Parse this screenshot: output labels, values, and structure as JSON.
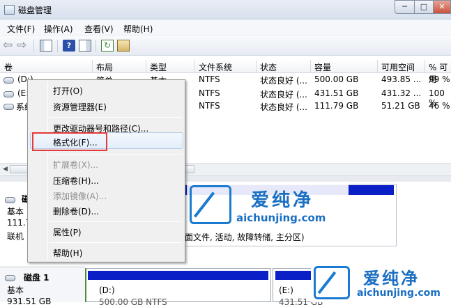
{
  "window": {
    "title": "磁盘管理",
    "buttons": {
      "min": "─",
      "max": "□",
      "close": "✕"
    }
  },
  "menubar": [
    "文件(F)",
    "操作(A)",
    "查看(V)",
    "帮助(H)"
  ],
  "toolbar": {
    "icons": [
      "back-icon",
      "forward-icon",
      "console-tree-icon",
      "help-icon",
      "action-pane-icon",
      "refresh-icon",
      "properties-icon"
    ],
    "back_glyph": "⇦",
    "forward_glyph": "⇨",
    "help_glyph": "?"
  },
  "columns": [
    "卷",
    "布局",
    "类型",
    "文件系统",
    "状态",
    "容量",
    "可用空间",
    "% 可用"
  ],
  "volumes": [
    {
      "name": "(D:)",
      "layout": "简单",
      "type": "基本",
      "fs": "NTFS",
      "status": "状态良好 (...",
      "capacity": "500.00 GB",
      "free": "493.85 ...",
      "pct": "99 %"
    },
    {
      "name": "(E:)",
      "layout": "",
      "type": "",
      "fs": "NTFS",
      "status": "状态良好 (...",
      "capacity": "431.51 GB",
      "free": "431.32 ...",
      "pct": "100 %"
    },
    {
      "name": "系统",
      "layout": "",
      "type": "",
      "fs": "NTFS",
      "status": "状态良好 (...",
      "capacity": "111.79 GB",
      "free": "51.21 GB",
      "pct": "46 %"
    }
  ],
  "scroll_left": "◀",
  "context_menu": {
    "items": [
      {
        "label": "打开(O)",
        "enabled": true
      },
      {
        "label": "资源管理器(E)",
        "enabled": true
      },
      {
        "label": "更改驱动器号和路径(C)...",
        "enabled": true
      },
      {
        "label": "格式化(F)...",
        "enabled": true,
        "highlighted": true
      },
      {
        "label": "扩展卷(X)...",
        "enabled": false
      },
      {
        "label": "压缩卷(H)...",
        "enabled": true
      },
      {
        "label": "添加镜像(A)...",
        "enabled": false
      },
      {
        "label": "删除卷(D)...",
        "enabled": true
      },
      {
        "label": "属性(P)",
        "enabled": true
      },
      {
        "label": "帮助(H)",
        "enabled": true
      }
    ]
  },
  "disk0": {
    "name": "磁",
    "type": "基本",
    "size": "111.7",
    "state": "联机",
    "partition_status": "面文件, 活动, 故障转储, 主分区)"
  },
  "disk1": {
    "name": "磁盘 1",
    "type": "基本",
    "size": "931.51 GB",
    "part_d_label": "(D:)",
    "part_d_detail": "500.00 GB NTFS",
    "part_e_label": "(E:)",
    "part_e_detail": "431.51 GB"
  },
  "watermark": {
    "brand": "爱纯净",
    "url": "aichunjing.com"
  },
  "colors": {
    "partition_bar": "#0a1fc6",
    "highlight_border": "#e43a3a",
    "watermark_blue": "#1a7bd0"
  }
}
